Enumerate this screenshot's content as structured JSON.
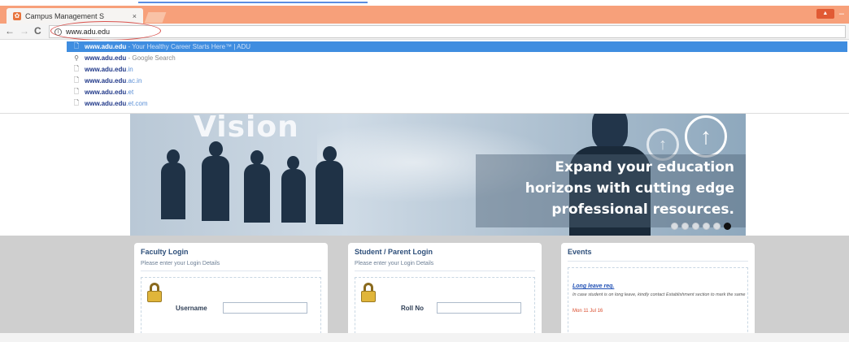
{
  "browser": {
    "tab_title": "Campus Management S",
    "tab_close": "×",
    "win_badge": "▲",
    "win_min": "–",
    "nav_back": "←",
    "nav_forward": "→",
    "nav_reload": "C",
    "address_info": "i",
    "address_url": "www.adu.edu"
  },
  "suggestions": [
    {
      "icon": "page-icon",
      "glyph": "🗋",
      "main": "www.adu.edu",
      "rest": "",
      "desc": " - Your Healthy Career Starts Here™ | ADU",
      "selected": true
    },
    {
      "icon": "search-icon",
      "glyph": "⚲",
      "main": "www.adu.edu",
      "rest": "",
      "desc": " - Google Search",
      "selected": false
    },
    {
      "icon": "page-icon",
      "glyph": "🗋",
      "main": "www.adu.edu",
      "rest": ".in",
      "desc": "",
      "selected": false
    },
    {
      "icon": "page-icon",
      "glyph": "🗋",
      "main": "www.adu.edu",
      "rest": ".ac.in",
      "desc": "",
      "selected": false
    },
    {
      "icon": "page-icon",
      "glyph": "🗋",
      "main": "www.adu.edu",
      "rest": ".et",
      "desc": "",
      "selected": false
    },
    {
      "icon": "page-icon",
      "glyph": "🗋",
      "main": "www.adu.edu",
      "rest": ".et.com",
      "desc": "",
      "selected": false
    }
  ],
  "hero": {
    "vision": "Vision",
    "tagline_1": "Expand your education",
    "tagline_2": "horizons with cutting edge",
    "tagline_3": "professional resources.",
    "arrow": "↑"
  },
  "faculty": {
    "title": "Faculty Login",
    "subtitle": "Please enter your Login Details",
    "username_label": "Username"
  },
  "student": {
    "title": "Student / Parent Login",
    "subtitle": "Please enter your Login Details",
    "rollno_label": "Roll No"
  },
  "events": {
    "title": "Events",
    "item_title": "Long leave req.",
    "item_text": "In case student is on long leave, kindly contact Establishment section to mark the same",
    "item_date": "Mon 11 Jul 16"
  }
}
